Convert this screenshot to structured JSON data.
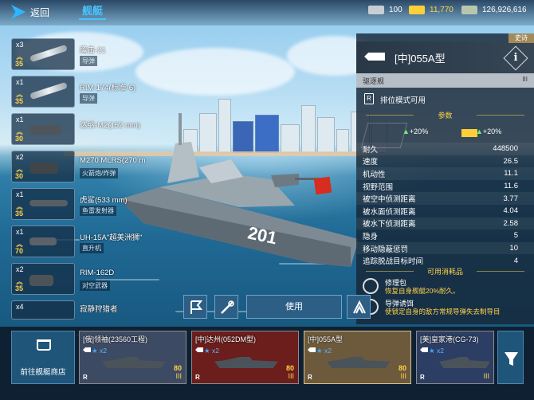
{
  "topbar": {
    "back_label": "返回",
    "tab_label": "舰艇",
    "currencies": [
      {
        "icon": "silver-bar-icon",
        "value": "100",
        "color": "#c9ced4"
      },
      {
        "icon": "gold-bar-icon",
        "value": "11,770",
        "color": "#ffcf3a"
      },
      {
        "icon": "cash-icon",
        "value": "126,926,616",
        "color": "#b7c6ad"
      }
    ]
  },
  "inventory": [
    {
      "count": "x3",
      "rank": "35",
      "name": "鹰击-21",
      "type": "导弹"
    },
    {
      "count": "x1",
      "rank": "35",
      "name": "RIM-174(标准-6)",
      "type": "导弹"
    },
    {
      "count": "x1",
      "rank": "30",
      "name": "达纳-M2(152 mm)",
      "type": ""
    },
    {
      "count": "x2",
      "rank": "30",
      "name": "M270 MLRS(270 m",
      "type": "火箭炮/炸弹"
    },
    {
      "count": "x1",
      "rank": "35",
      "name": "虎鲨(533 mm)",
      "type": "鱼雷发射器"
    },
    {
      "count": "x1",
      "rank": "70",
      "name": "UH-15A\"超美洲狮\"",
      "type": "直升机"
    },
    {
      "count": "x2",
      "rank": "35",
      "name": "RIM-162D",
      "type": "对空武器"
    },
    {
      "count": "x4",
      "rank": "",
      "name": "寂静狩猎者",
      "type": ""
    }
  ],
  "ship_hull_number": "201",
  "panel": {
    "rarity": "史诗",
    "name": "[中]055A型",
    "ship_class": "驱逐舰",
    "class_level": "III",
    "rank_mode": "排位模式可用",
    "params_title": "参数",
    "bonuses": [
      "+20%",
      "+20%"
    ],
    "stats": [
      {
        "label": "耐久",
        "value": "448500"
      },
      {
        "label": "速度",
        "value": "26.5"
      },
      {
        "label": "机动性",
        "value": "11.1"
      },
      {
        "label": "视野范围",
        "value": "11.6"
      },
      {
        "label": "被空中侦测距离",
        "value": "3.77"
      },
      {
        "label": "被水面侦测距离",
        "value": "4.04"
      },
      {
        "label": "被水下侦测距离",
        "value": "2.58"
      },
      {
        "label": "隐身",
        "value": "5"
      },
      {
        "label": "移动隐蔽惩罚",
        "value": "10"
      },
      {
        "label": "追踪脱战目标时间",
        "value": "4"
      }
    ],
    "consumables_title": "可用消耗品",
    "consumables": [
      {
        "name": "修理包",
        "desc": "恢复自身舰艇20%耐久。"
      },
      {
        "name": "导弹诱饵",
        "desc": "使锁定自身的敌方常规导弹失去制导目"
      }
    ]
  },
  "actions": {
    "use_label": "使用"
  },
  "bottom": {
    "shop_label": "前往舰艇商店",
    "ships": [
      {
        "name": "[俄]领袖(23560工程)",
        "stars": "x2",
        "level": "80",
        "tier": "III",
        "bg": "#3d4a63"
      },
      {
        "name": "[中]达州(052DM型)",
        "stars": "x2",
        "level": "80",
        "tier": "III",
        "bg": "#6b1e1c"
      },
      {
        "name": "[中]055A型",
        "stars": "x2",
        "level": "80",
        "tier": "III",
        "bg": "#6d5a3c"
      },
      {
        "name": "[美]皇家港(CG-73)",
        "stars": "x2",
        "level": "",
        "tier": "III",
        "bg": "#2c3e63"
      }
    ]
  }
}
